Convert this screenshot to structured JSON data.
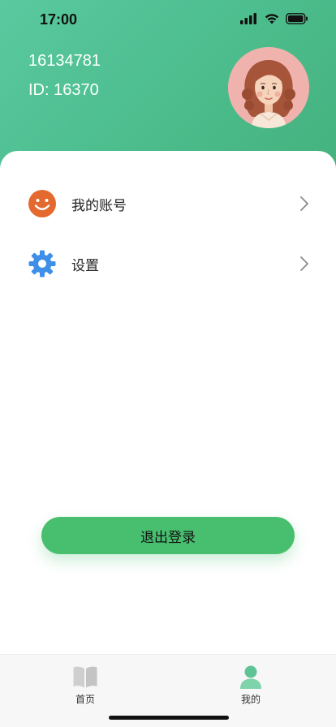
{
  "status_bar": {
    "time": "17:00",
    "icons": [
      "signal-icon",
      "wifi-icon",
      "battery-icon"
    ]
  },
  "profile": {
    "name": "16134781",
    "id_text": "ID:  16370"
  },
  "menu": {
    "items": [
      {
        "label": "我的账号",
        "icon": "smiley-icon"
      },
      {
        "label": "设置",
        "icon": "gear-icon"
      }
    ]
  },
  "logout": {
    "label": "退出登录"
  },
  "tabbar": {
    "tabs": [
      {
        "label": "首页",
        "icon": "book-icon",
        "active": false
      },
      {
        "label": "我的",
        "icon": "person-icon",
        "active": true
      }
    ]
  },
  "colors": {
    "header_start": "#5ac9a0",
    "header_end": "#45b27e",
    "accent_green": "#48bf6f",
    "smiley_orange": "#e4692f",
    "gear_blue": "#3f8fe8",
    "tab_active": "#5fc495",
    "tab_inactive": "#c9c9c9"
  }
}
